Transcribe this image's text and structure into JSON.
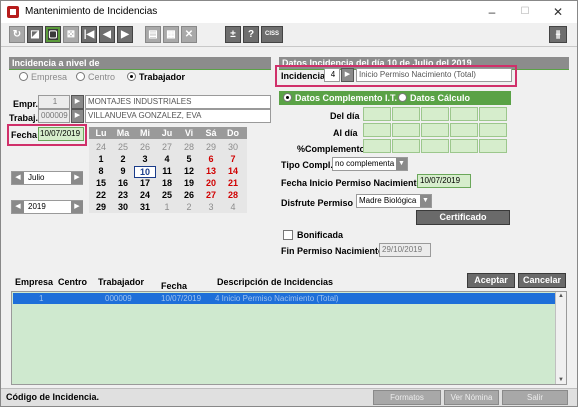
{
  "window": {
    "title": "Mantenimiento de Incidencias",
    "minimize": "–",
    "maximize": "☐",
    "close": "✕"
  },
  "toolbar": {
    "btn_plusminus": "±",
    "btn_help": "?",
    "btn_ciss": "CISS"
  },
  "left": {
    "section_title": "Incidencia a nivel de",
    "level_options": [
      "Empresa",
      "Centro",
      "Trabajador"
    ],
    "selected_level": "Trabajador",
    "empr_label": "Empr.",
    "empr_code": "1",
    "empr_name": "MONTAJES INDUSTRIALES",
    "trabaj_label": "Trabaj.",
    "trabaj_code": "000009",
    "trabaj_name": "VILLANUEVA GONZALEZ, EVA",
    "fecha_label": "Fecha",
    "fecha_value": "10/07/2019"
  },
  "calendar": {
    "month": "Julio",
    "year": "2019",
    "day_names": [
      "Lu",
      "Ma",
      "Mi",
      "Ju",
      "Vi",
      "Sá",
      "Do"
    ],
    "weeks": [
      [
        "24",
        "25",
        "26",
        "27",
        "28",
        "29",
        "30"
      ],
      [
        "1",
        "2",
        "3",
        "4",
        "5",
        "6",
        "7"
      ],
      [
        "8",
        "9",
        "10",
        "11",
        "12",
        "13",
        "14"
      ],
      [
        "15",
        "16",
        "17",
        "18",
        "19",
        "20",
        "21"
      ],
      [
        "22",
        "23",
        "24",
        "25",
        "26",
        "27",
        "28"
      ],
      [
        "29",
        "30",
        "31",
        "1",
        "2",
        "3",
        "4"
      ]
    ],
    "selected_day": "10"
  },
  "right": {
    "section_title": "Datos Incidencia del día 10 de Julio del 2019",
    "incidencia_label": "Incidencia",
    "incidencia_code": "4",
    "incidencia_desc": "Inicio Permiso Nacimiento (Total)",
    "tab_complemento": "Datos Complemento I.T.",
    "tab_calculo": "Datos Cálculo",
    "del_dia_label": "Del día",
    "al_dia_label": "Al día",
    "pct_complemento_label": "%Complemento",
    "tipo_compl_label": "Tipo Compl.",
    "tipo_compl_value": "no complementa",
    "fecha_inicio_label": "Fecha Inicio Permiso Nacimiento",
    "fecha_inicio_value": "10/07/2019",
    "disfrute_label": "Disfrute Permiso",
    "disfrute_value": "Madre Biológica",
    "certificado_button": "Certificado",
    "bonificada_label": "Bonificada",
    "fin_permiso_label": "Fin Permiso Nacimiento",
    "fin_permiso_value": "29/10/2019"
  },
  "list": {
    "headers": [
      "Empresa",
      "Centro",
      "Trabajador",
      "Fecha",
      "Descripción de Incidencias"
    ],
    "accept_button": "Aceptar",
    "cancel_button": "Cancelar",
    "row": {
      "empresa": "1",
      "trabajador": "000009",
      "fecha": "10/07/2019",
      "descripcion": "4  Inicio Permiso Nacimiento (Total)"
    }
  },
  "status": {
    "text": "Código de Incidencia.",
    "formatos_button": "Formatos",
    "ver_nomina_button": "Ver Nómina",
    "salir_button": "Salir"
  }
}
